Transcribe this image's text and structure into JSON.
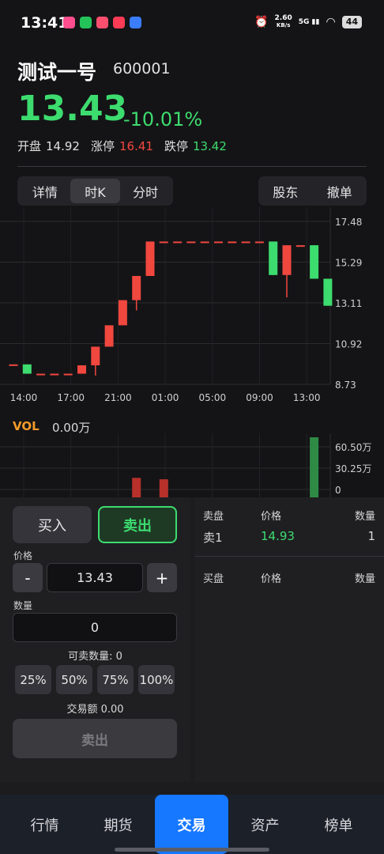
{
  "status": {
    "time": "13:41",
    "net_speed_value": "2.60",
    "net_speed_unit": "KB/s",
    "signal": "5G",
    "battery": "44"
  },
  "stock": {
    "name": "测试一号",
    "code": "600001",
    "price": "13.43",
    "change": "-10.01%",
    "open_label": "开盘",
    "open_value": "14.92",
    "limit_up_label": "涨停",
    "limit_up_value": "16.41",
    "limit_down_label": "跌停",
    "limit_down_value": "13.42"
  },
  "tabs": {
    "left": [
      "详情",
      "时K",
      "分时"
    ],
    "active_left": 1,
    "right": [
      "股东",
      "撤单"
    ]
  },
  "chart_data": {
    "type": "candlestick",
    "y_ticks": [
      "17.48",
      "15.29",
      "13.11",
      "10.92",
      "8.73"
    ],
    "ylim": [
      8.73,
      17.48
    ],
    "x_ticks": [
      "14:00",
      "17:00",
      "21:00",
      "01:00",
      "05:00",
      "09:00",
      "13:00"
    ],
    "candles": [
      {
        "open": 9.8,
        "close": 9.8,
        "high": 9.8,
        "low": 9.8
      },
      {
        "open": 9.8,
        "close": 9.3,
        "high": 9.8,
        "low": 9.3
      },
      {
        "open": 9.3,
        "close": 9.3,
        "high": 9.3,
        "low": 9.3
      },
      {
        "open": 9.3,
        "close": 9.3,
        "high": 9.3,
        "low": 9.3
      },
      {
        "open": 9.3,
        "close": 9.3,
        "high": 9.3,
        "low": 9.3
      },
      {
        "open": 9.3,
        "close": 9.75,
        "high": 9.75,
        "low": 9.3
      },
      {
        "open": 9.75,
        "close": 10.75,
        "high": 10.75,
        "low": 9.2
      },
      {
        "open": 10.75,
        "close": 11.9,
        "high": 11.9,
        "low": 10.75
      },
      {
        "open": 11.9,
        "close": 13.25,
        "high": 13.25,
        "low": 11.9
      },
      {
        "open": 13.25,
        "close": 14.55,
        "high": 14.55,
        "low": 12.7
      },
      {
        "open": 14.55,
        "close": 16.4,
        "high": 16.4,
        "low": 14.55
      },
      {
        "open": 16.4,
        "close": 16.4,
        "high": 16.4,
        "low": 16.4
      },
      {
        "open": 16.4,
        "close": 16.4,
        "high": 16.4,
        "low": 16.4
      },
      {
        "open": 16.4,
        "close": 16.4,
        "high": 16.4,
        "low": 16.4
      },
      {
        "open": 16.4,
        "close": 16.4,
        "high": 16.4,
        "low": 16.4
      },
      {
        "open": 16.4,
        "close": 16.4,
        "high": 16.4,
        "low": 16.4
      },
      {
        "open": 16.4,
        "close": 16.4,
        "high": 16.4,
        "low": 16.4
      },
      {
        "open": 16.4,
        "close": 16.4,
        "high": 16.4,
        "low": 16.4
      },
      {
        "open": 16.4,
        "close": 16.4,
        "high": 16.4,
        "low": 16.4
      },
      {
        "open": 16.4,
        "close": 14.6,
        "high": 16.4,
        "low": 14.6
      },
      {
        "open": 14.6,
        "close": 16.2,
        "high": 16.2,
        "low": 13.4
      },
      {
        "open": 16.2,
        "close": 16.2,
        "high": 16.2,
        "low": 16.2
      },
      {
        "open": 16.2,
        "close": 14.4,
        "high": 16.2,
        "low": 14.4
      },
      {
        "open": 14.4,
        "close": 12.95,
        "high": 14.4,
        "low": 12.95
      }
    ],
    "volume_label": "VOL",
    "volume_value": "0.00万",
    "volume_ticks": [
      "60.50万",
      "30.25万",
      "0"
    ],
    "volume_ylim": [
      0,
      60.5
    ]
  },
  "trade": {
    "buy_label": "买入",
    "sell_label": "卖出",
    "price_label": "价格",
    "price_minus": "-",
    "price_value": "13.43",
    "price_plus": "+",
    "qty_label": "数量",
    "qty_value": "0",
    "sellable": "可卖数量: 0",
    "pcts": [
      "25%",
      "50%",
      "75%",
      "100%"
    ],
    "amount": "交易额 0.00",
    "submit_label": "卖出"
  },
  "orderbook": {
    "ask_header": [
      "卖盘",
      "价格",
      "数量"
    ],
    "asks": [
      {
        "label": "卖1",
        "price": "14.93",
        "qty": "1"
      }
    ],
    "bid_header": [
      "买盘",
      "价格",
      "数量"
    ]
  },
  "nav": {
    "items": [
      "行情",
      "期货",
      "交易",
      "资产",
      "榜单"
    ],
    "active": 2
  },
  "colors": {
    "up": "#f0473f",
    "down": "#3ddc6f",
    "accent": "#1677ff",
    "volume_label": "#f39a2a"
  }
}
